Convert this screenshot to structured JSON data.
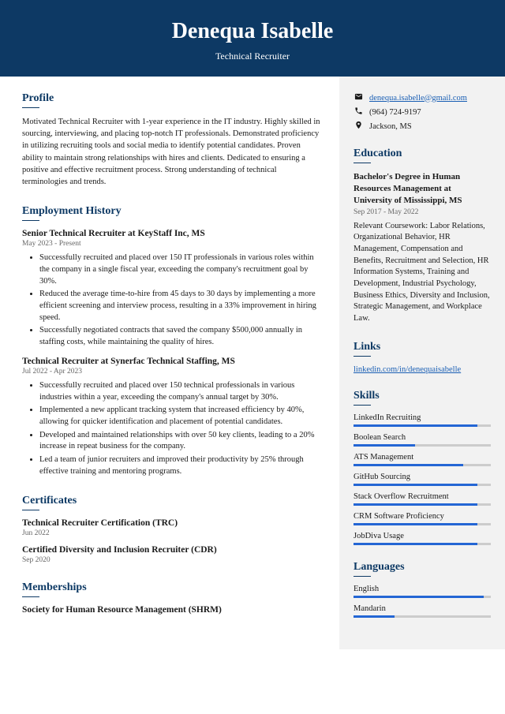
{
  "header": {
    "name": "Denequa Isabelle",
    "title": "Technical Recruiter"
  },
  "profile": {
    "heading": "Profile",
    "text": "Motivated Technical Recruiter with 1-year experience in the IT industry. Highly skilled in sourcing, interviewing, and placing top-notch IT professionals. Demonstrated proficiency in utilizing recruiting tools and social media to identify potential candidates. Proven ability to maintain strong relationships with hires and clients. Dedicated to ensuring a positive and effective recruitment process. Strong understanding of technical terminologies and trends."
  },
  "employment": {
    "heading": "Employment History",
    "jobs": [
      {
        "title": "Senior Technical Recruiter at KeyStaff Inc, MS",
        "dates": "May 2023 - Present",
        "bullets": [
          "Successfully recruited and placed over 150 IT professionals in various roles within the company in a single fiscal year, exceeding the company's recruitment goal by 30%.",
          "Reduced the average time-to-hire from 45 days to 30 days by implementing a more efficient screening and interview process, resulting in a 33% improvement in hiring speed.",
          "Successfully negotiated contracts that saved the company $500,000 annually in staffing costs, while maintaining the quality of hires."
        ]
      },
      {
        "title": "Technical Recruiter at Synerfac Technical Staffing, MS",
        "dates": "Jul 2022 - Apr 2023",
        "bullets": [
          "Successfully recruited and placed over 150 technical professionals in various industries within a year, exceeding the company's annual target by 30%.",
          "Implemented a new applicant tracking system that increased efficiency by 40%, allowing for quicker identification and placement of potential candidates.",
          "Developed and maintained relationships with over 50 key clients, leading to a 20% increase in repeat business for the company.",
          "Led a team of junior recruiters and improved their productivity by 25% through effective training and mentoring programs."
        ]
      }
    ]
  },
  "certificates": {
    "heading": "Certificates",
    "items": [
      {
        "title": "Technical Recruiter Certification (TRC)",
        "date": "Jun 2022"
      },
      {
        "title": "Certified Diversity and Inclusion Recruiter (CDR)",
        "date": "Sep 2020"
      }
    ]
  },
  "memberships": {
    "heading": "Memberships",
    "items": [
      {
        "title": "Society for Human Resource Management (SHRM)"
      }
    ]
  },
  "contact": {
    "email": "denequa.isabelle@gmail.com",
    "phone": "(964) 724-9197",
    "location": "Jackson, MS"
  },
  "education": {
    "heading": "Education",
    "degree": "Bachelor's Degree in Human Resources Management at University of Mississippi, MS",
    "dates": "Sep 2017 - May 2022",
    "text": "Relevant Coursework: Labor Relations, Organizational Behavior, HR Management, Compensation and Benefits, Recruitment and Selection, HR Information Systems, Training and Development, Industrial Psychology, Business Ethics, Diversity and Inclusion, Strategic Management, and Workplace Law."
  },
  "links": {
    "heading": "Links",
    "url": "linkedin.com/in/denequaisabelle"
  },
  "skills": {
    "heading": "Skills",
    "items": [
      {
        "name": "LinkedIn Recruiting",
        "level": 90
      },
      {
        "name": "Boolean Search",
        "level": 45
      },
      {
        "name": "ATS Management",
        "level": 80
      },
      {
        "name": "GitHub Sourcing",
        "level": 90
      },
      {
        "name": "Stack Overflow Recruitment",
        "level": 90
      },
      {
        "name": "CRM Software Proficiency",
        "level": 90
      },
      {
        "name": "JobDiva Usage",
        "level": 90
      }
    ]
  },
  "languages": {
    "heading": "Languages",
    "items": [
      {
        "name": "English",
        "level": 95
      },
      {
        "name": "Mandarin",
        "level": 30
      }
    ]
  }
}
